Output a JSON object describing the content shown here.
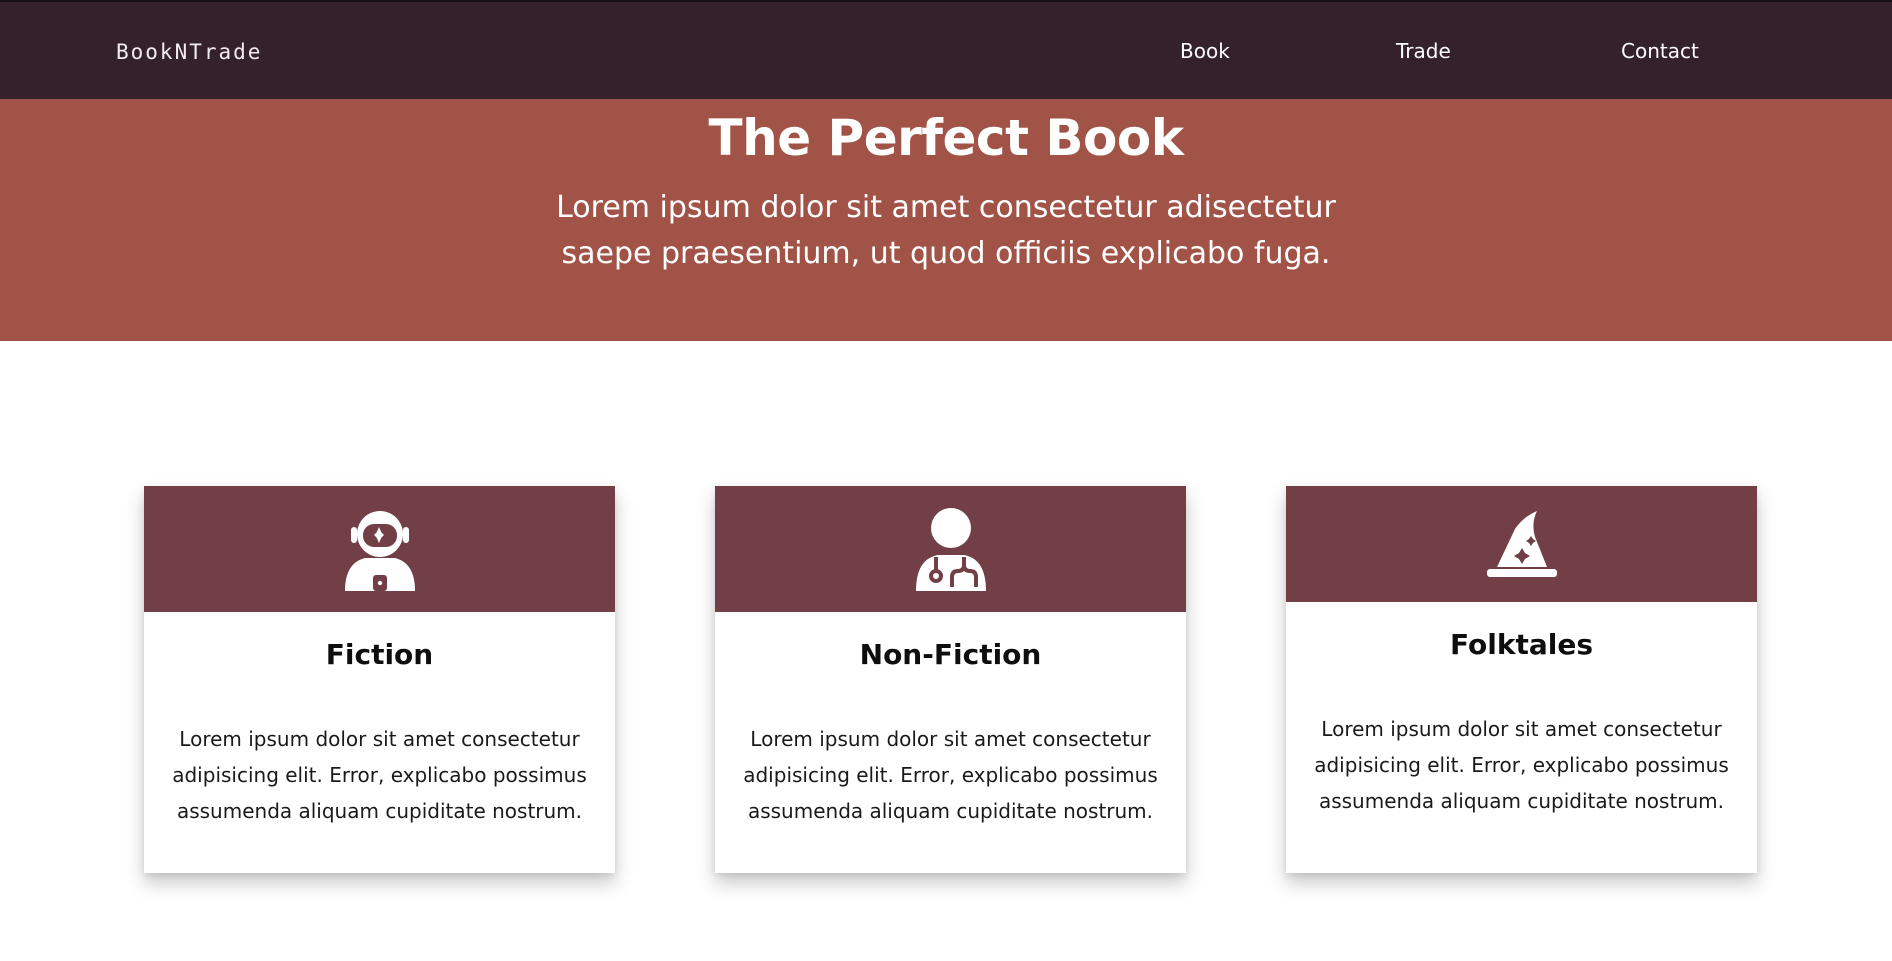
{
  "nav": {
    "brand": "BookNTrade",
    "links": [
      "Book",
      "Trade",
      "Contact"
    ]
  },
  "hero": {
    "title": "The Perfect Book",
    "subtitle": "Lorem ipsum dolor sit amet consectetur adisectetur saepe praesentium, ut quod officiis explicabo fuga."
  },
  "cards": [
    {
      "icon": "astronaut-icon",
      "title": "Fiction",
      "text": "Lorem ipsum dolor sit amet consectetur adipisicing elit. Error, explicabo possimus assumenda aliquam cupiditate nostrum."
    },
    {
      "icon": "doctor-icon",
      "title": "Non-Fiction",
      "text": "Lorem ipsum dolor sit amet consectetur adipisicing elit. Error, explicabo possimus assumenda aliquam cupiditate nostrum."
    },
    {
      "icon": "wizard-hat-icon",
      "title": "Folktales",
      "text": "Lorem ipsum dolor sit amet consectetur adipisicing elit. Error, explicabo possimus assumenda aliquam cupiditate nostrum."
    }
  ],
  "colors": {
    "navbar": "#35212a",
    "hero": "#a05346",
    "card_header": "#733f46"
  }
}
